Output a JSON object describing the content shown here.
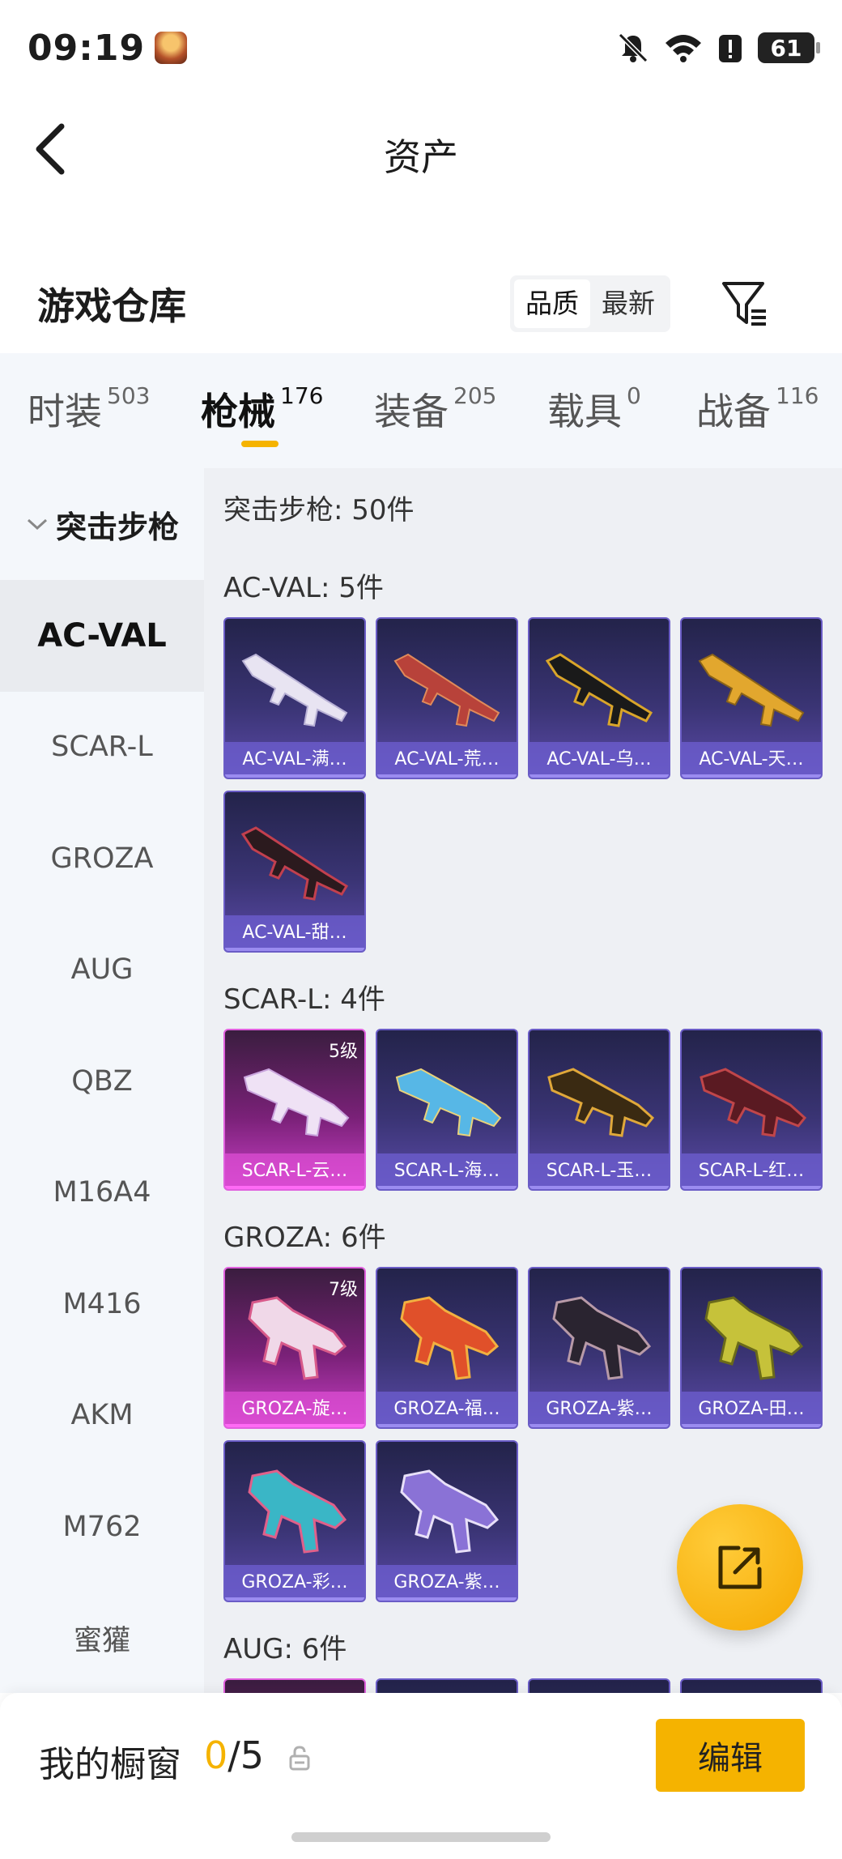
{
  "status_bar": {
    "time": "09:19",
    "battery": "61"
  },
  "nav": {
    "title": "资产"
  },
  "section": {
    "title": "游戏仓库",
    "sort_options": [
      "品质",
      "最新"
    ]
  },
  "tabs": [
    {
      "label": "时装",
      "count": "503"
    },
    {
      "label": "枪械",
      "count": "176"
    },
    {
      "label": "装备",
      "count": "205"
    },
    {
      "label": "载具",
      "count": "0"
    },
    {
      "label": "战备",
      "count": "116"
    }
  ],
  "sidebar": {
    "group_label": "突击步枪",
    "items": [
      "AC-VAL",
      "SCAR-L",
      "GROZA",
      "AUG",
      "QBZ",
      "M16A4",
      "M416",
      "AKM",
      "M762",
      "蜜獾"
    ]
  },
  "content": {
    "summary": "突击步枪: 50件",
    "groups": [
      {
        "title": "AC-VAL: 5件",
        "items": [
          {
            "name": "AC-VAL-满…",
            "level": ""
          },
          {
            "name": "AC-VAL-荒…",
            "level": ""
          },
          {
            "name": "AC-VAL-乌…",
            "level": ""
          },
          {
            "name": "AC-VAL-天…",
            "level": ""
          },
          {
            "name": "AC-VAL-甜…",
            "level": ""
          }
        ]
      },
      {
        "title": "SCAR-L: 4件",
        "items": [
          {
            "name": "SCAR-L-云…",
            "level": "5级"
          },
          {
            "name": "SCAR-L-海…",
            "level": ""
          },
          {
            "name": "SCAR-L-玉…",
            "level": ""
          },
          {
            "name": "SCAR-L-红…",
            "level": ""
          }
        ]
      },
      {
        "title": "GROZA: 6件",
        "items": [
          {
            "name": "GROZA-旋…",
            "level": "7级"
          },
          {
            "name": "GROZA-福…",
            "level": ""
          },
          {
            "name": "GROZA-紫…",
            "level": ""
          },
          {
            "name": "GROZA-田…",
            "level": ""
          },
          {
            "name": "GROZA-彩…",
            "level": ""
          },
          {
            "name": "GROZA-紫…",
            "level": ""
          }
        ]
      },
      {
        "title": "AUG: 6件",
        "items": []
      }
    ]
  },
  "bottom": {
    "showcase_label": "我的橱窗",
    "used": "0",
    "total": "/5",
    "edit_label": "编辑"
  },
  "colors": {
    "accent": "#f5b300",
    "card_blue": "#3a3474",
    "card_purple": "#c93fc6"
  },
  "icons": [
    "back-arrow-icon",
    "filter-icon",
    "share-icon",
    "lock-icon",
    "mute-icon",
    "wifi-icon",
    "alert-icon"
  ]
}
